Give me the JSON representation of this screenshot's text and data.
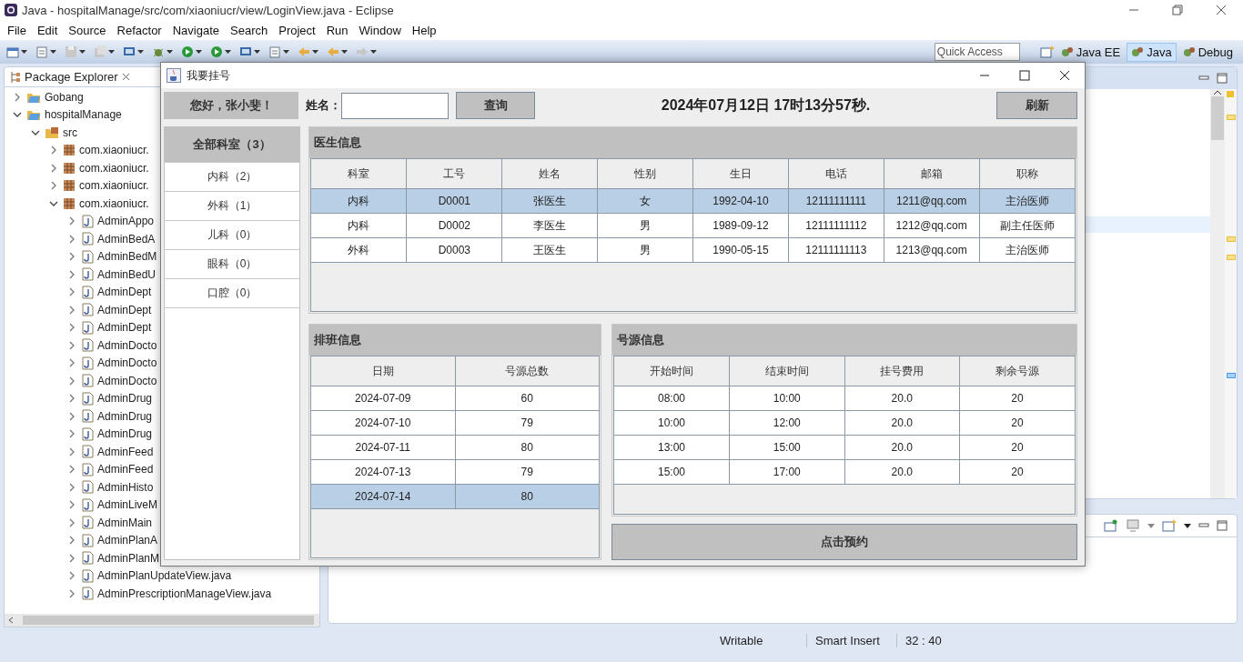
{
  "window": {
    "title": "Java - hospitalManage/src/com/xiaoniucr/view/LoginView.java - Eclipse"
  },
  "menu": [
    "File",
    "Edit",
    "Source",
    "Refactor",
    "Navigate",
    "Search",
    "Project",
    "Run",
    "Window",
    "Help"
  ],
  "quick_access": {
    "placeholder": "Quick Access"
  },
  "perspectives": [
    {
      "label": "Java EE",
      "selected": false
    },
    {
      "label": "Java",
      "selected": true
    },
    {
      "label": "Debug",
      "selected": false
    }
  ],
  "package_explorer": {
    "title": "Package Explorer",
    "tree": [
      {
        "label": "Gobang",
        "kind": "project",
        "expanded": false
      },
      {
        "label": "hospitalManage",
        "kind": "project",
        "expanded": true,
        "children": [
          {
            "label": "src",
            "kind": "source",
            "expanded": true,
            "children": [
              {
                "label": "com.xiaoniucr.",
                "kind": "package",
                "expanded": false
              },
              {
                "label": "com.xiaoniucr.",
                "kind": "package",
                "expanded": false
              },
              {
                "label": "com.xiaoniucr.",
                "kind": "package",
                "expanded": false
              },
              {
                "label": "com.xiaoniucr.",
                "kind": "package",
                "expanded": true,
                "children": [
                  {
                    "label": "AdminAppo",
                    "kind": "file",
                    "expanded": false
                  },
                  {
                    "label": "AdminBedA",
                    "kind": "file",
                    "expanded": false
                  },
                  {
                    "label": "AdminBedM",
                    "kind": "file",
                    "expanded": false
                  },
                  {
                    "label": "AdminBedU",
                    "kind": "file",
                    "expanded": false
                  },
                  {
                    "label": "AdminDept",
                    "kind": "file",
                    "expanded": false
                  },
                  {
                    "label": "AdminDept",
                    "kind": "file",
                    "expanded": false
                  },
                  {
                    "label": "AdminDept",
                    "kind": "file",
                    "expanded": false
                  },
                  {
                    "label": "AdminDocto",
                    "kind": "file",
                    "expanded": false
                  },
                  {
                    "label": "AdminDocto",
                    "kind": "file",
                    "expanded": false
                  },
                  {
                    "label": "AdminDocto",
                    "kind": "file",
                    "expanded": false
                  },
                  {
                    "label": "AdminDrug",
                    "kind": "file",
                    "expanded": false
                  },
                  {
                    "label": "AdminDrug",
                    "kind": "file",
                    "expanded": false
                  },
                  {
                    "label": "AdminDrug",
                    "kind": "file",
                    "expanded": false
                  },
                  {
                    "label": "AdminFeed",
                    "kind": "file",
                    "expanded": false
                  },
                  {
                    "label": "AdminFeed",
                    "kind": "file",
                    "expanded": false
                  },
                  {
                    "label": "AdminHisto",
                    "kind": "file",
                    "expanded": false
                  },
                  {
                    "label": "AdminLiveM",
                    "kind": "file",
                    "expanded": false
                  },
                  {
                    "label": "AdminMain",
                    "kind": "file",
                    "expanded": false
                  },
                  {
                    "label": "AdminPlanA",
                    "kind": "file",
                    "expanded": false
                  },
                  {
                    "label": "AdminPlanM",
                    "kind": "file",
                    "expanded": false
                  },
                  {
                    "label": "AdminPlanUpdateView.java",
                    "kind": "file",
                    "expanded": false
                  },
                  {
                    "label": "AdminPrescriptionManageView.java",
                    "kind": "file",
                    "expanded": false
                  }
                ]
              }
            ]
          }
        ]
      }
    ]
  },
  "status_bar": [
    "Writable",
    "Smart Insert",
    "32 : 40"
  ],
  "dialog": {
    "title": "我要挂号",
    "greeting": "您好，张小斐！",
    "search": {
      "label": "姓名：",
      "button": "查询"
    },
    "datetime": "2024年07月12日 17时13分57秒.",
    "refresh_button": "刷新",
    "departments": [
      {
        "label": "全部科室（3）",
        "selected": true
      },
      {
        "label": "内科（2）",
        "selected": false
      },
      {
        "label": "外科（1）",
        "selected": false
      },
      {
        "label": "儿科（0）",
        "selected": false
      },
      {
        "label": "眼科（0）",
        "selected": false
      },
      {
        "label": "口腔（0）",
        "selected": false
      }
    ],
    "doctors": {
      "title": "医生信息",
      "columns": [
        "科室",
        "工号",
        "姓名",
        "性别",
        "生日",
        "电话",
        "邮箱",
        "职称"
      ],
      "rows": [
        {
          "cells": [
            "内科",
            "D0001",
            "张医生",
            "女",
            "1992-04-10",
            "12111111111",
            "1211@qq.com",
            "主治医师"
          ],
          "selected": true
        },
        {
          "cells": [
            "内科",
            "D0002",
            "李医生",
            "男",
            "1989-09-12",
            "12111111112",
            "1212@qq.com",
            "副主任医师"
          ],
          "selected": false
        },
        {
          "cells": [
            "外科",
            "D0003",
            "王医生",
            "男",
            "1990-05-15",
            "12111111113",
            "1213@qq.com",
            "主治医师"
          ],
          "selected": false
        }
      ]
    },
    "schedule": {
      "title": "排班信息",
      "columns": [
        "日期",
        "号源总数"
      ],
      "rows": [
        {
          "cells": [
            "2024-07-09",
            "60"
          ],
          "selected": false
        },
        {
          "cells": [
            "2024-07-10",
            "79"
          ],
          "selected": false
        },
        {
          "cells": [
            "2024-07-11",
            "80"
          ],
          "selected": false
        },
        {
          "cells": [
            "2024-07-13",
            "79"
          ],
          "selected": false
        },
        {
          "cells": [
            "2024-07-14",
            "80"
          ],
          "selected": true
        }
      ]
    },
    "slots": {
      "title": "号源信息",
      "columns": [
        "开始时间",
        "结束时间",
        "挂号费用",
        "剩余号源"
      ],
      "rows": [
        {
          "cells": [
            "08:00",
            "10:00",
            "20.0",
            "20"
          ],
          "selected": false
        },
        {
          "cells": [
            "10:00",
            "12:00",
            "20.0",
            "20"
          ],
          "selected": false
        },
        {
          "cells": [
            "13:00",
            "15:00",
            "20.0",
            "20"
          ],
          "selected": false
        },
        {
          "cells": [
            "15:00",
            "17:00",
            "20.0",
            "20"
          ],
          "selected": false
        }
      ]
    },
    "book_button": "点击预约"
  }
}
